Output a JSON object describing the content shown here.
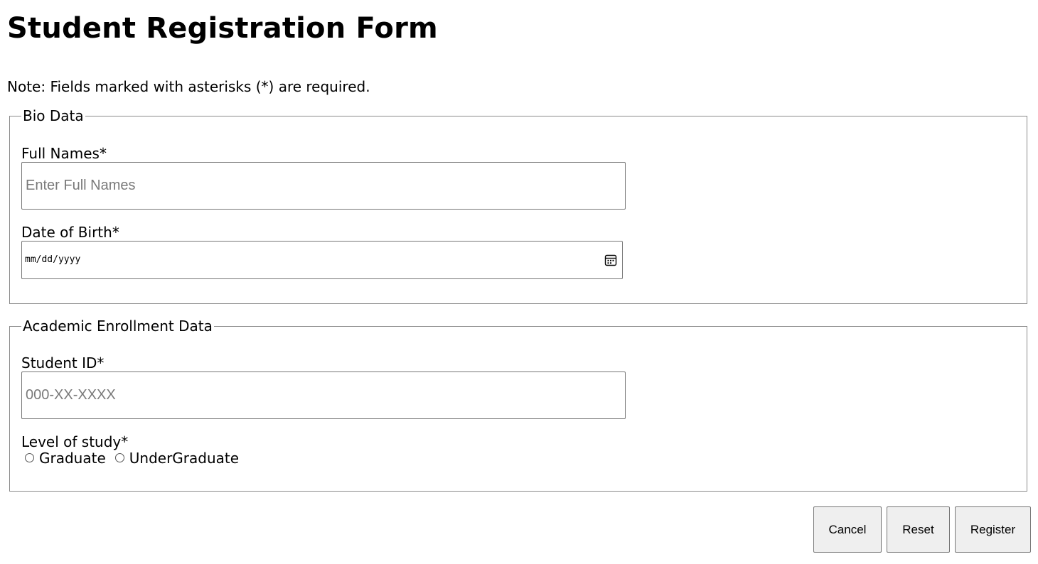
{
  "page": {
    "title": "Student Registration Form",
    "note": "Note: Fields marked with asterisks (*) are required."
  },
  "bio": {
    "legend": "Bio Data",
    "full_names_label": "Full Names*",
    "full_names_placeholder": "Enter Full Names",
    "full_names_value": "",
    "dob_label": "Date of Birth*",
    "dob_placeholder": "mm/dd/yyyy",
    "dob_icon": "calendar-icon"
  },
  "academic": {
    "legend": "Academic Enrollment Data",
    "student_id_label": "Student ID*",
    "student_id_placeholder": "000-XX-XXXX",
    "student_id_value": "",
    "level_label": "Level of study*",
    "options": [
      "Graduate",
      "UnderGraduate"
    ],
    "selected": null
  },
  "actions": {
    "cancel_label": "Cancel",
    "reset_label": "Reset",
    "register_label": "Register"
  }
}
